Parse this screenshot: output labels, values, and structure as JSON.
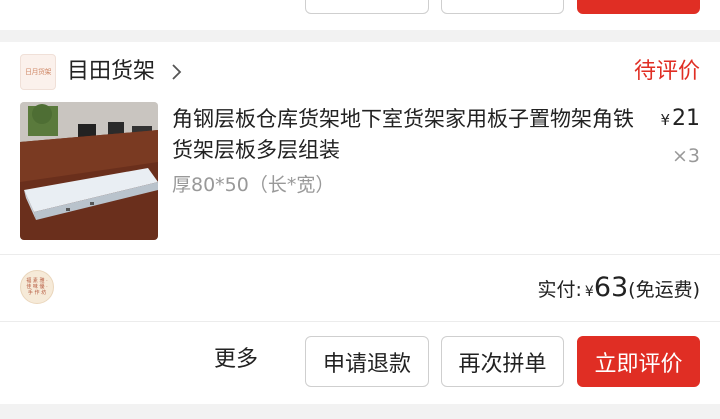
{
  "store": {
    "logo_text": "日月货架",
    "name": "目田货架",
    "status": "待评价"
  },
  "product": {
    "title": "角钢层板仓库货架地下室货架家用板子置物架角铁货架层板多层组装",
    "spec": "厚80*50（长*宽）",
    "price_symbol": "¥",
    "price": "21",
    "quantity": "×3"
  },
  "payment": {
    "label": "实付:",
    "symbol": "¥",
    "amount": "63",
    "note": "(免运费)",
    "avatar_text": "福 素 雅 · 佳 味 優 · 手 作 坊"
  },
  "actions": {
    "more": "更多",
    "refund": "申请退款",
    "rebuy": "再次拼单",
    "review": "立即评价"
  },
  "colors": {
    "accent": "#e02e24"
  }
}
